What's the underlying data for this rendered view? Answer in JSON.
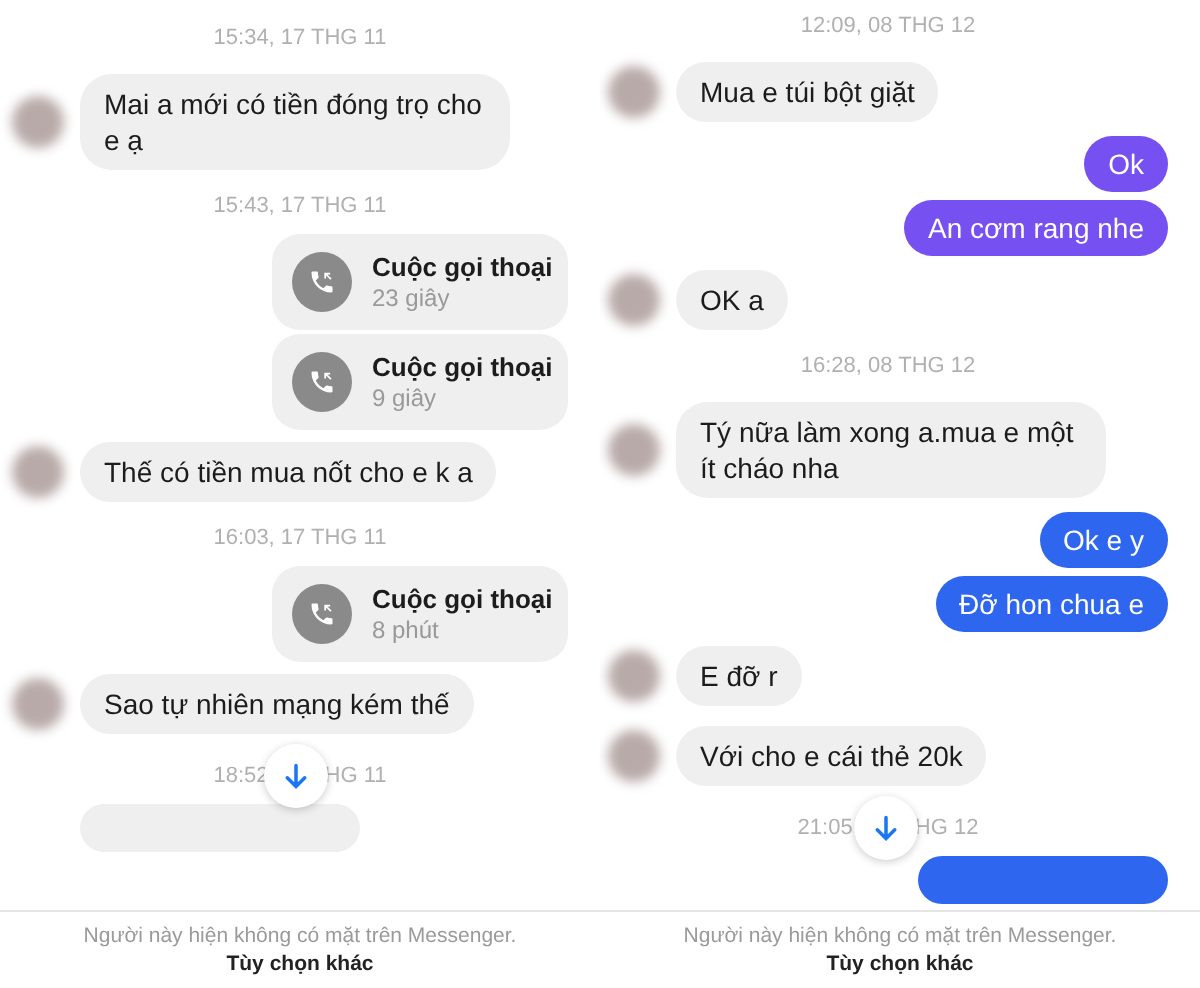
{
  "panels": [
    {
      "messages": [
        {
          "kind": "time",
          "text": "15:34, 17 THG 11"
        },
        {
          "kind": "incoming",
          "text": "Mai a mới có tiền đóng trọ cho e ạ"
        },
        {
          "kind": "time",
          "text": "15:43, 17 THG 11"
        },
        {
          "kind": "call",
          "title": "Cuộc gọi thoại",
          "duration": "23 giây"
        },
        {
          "kind": "call",
          "title": "Cuộc gọi thoại",
          "duration": "9 giây"
        },
        {
          "kind": "incoming",
          "text": "Thế có tiền mua nốt cho e k a"
        },
        {
          "kind": "time",
          "text": "16:03, 17 THG 11"
        },
        {
          "kind": "call",
          "title": "Cuộc gọi thoại",
          "duration": "8 phút"
        },
        {
          "kind": "incoming",
          "text": "Sao tự nhiên mạng kém thế"
        },
        {
          "kind": "time_covered",
          "before": "18:52",
          "after": "HG 11"
        },
        {
          "kind": "cut_incoming"
        }
      ],
      "footer": {
        "text": "Người này hiện không có mặt trên Messenger.",
        "link": "Tùy chọn khác"
      }
    },
    {
      "messages": [
        {
          "kind": "time",
          "text": "12:09, 08 THG 12"
        },
        {
          "kind": "incoming",
          "text": "Mua e túi bột giặt"
        },
        {
          "kind": "outgoing",
          "text": "Ok",
          "color": "#7650f0"
        },
        {
          "kind": "outgoing",
          "text": "An cơm rang nhe",
          "color": "#7650f0"
        },
        {
          "kind": "incoming",
          "text": "OK a"
        },
        {
          "kind": "time",
          "text": "16:28, 08 THG 12"
        },
        {
          "kind": "incoming",
          "text": "Tý nữa làm xong a.mua e một ít cháo nha"
        },
        {
          "kind": "outgoing",
          "text": "Ok e y",
          "color": "#2f66f0"
        },
        {
          "kind": "outgoing",
          "text": "Đỡ hon chua e",
          "color": "#2f66f0"
        },
        {
          "kind": "incoming",
          "text": "E đỡ r"
        },
        {
          "kind": "incoming",
          "text": "Với cho e cái thẻ 20k"
        },
        {
          "kind": "time_covered",
          "before": "21:05,",
          "after": "HG 12"
        },
        {
          "kind": "cut_outgoing",
          "color": "#2f66f0"
        }
      ],
      "footer": {
        "text": "Người này hiện không có mặt trên Messenger.",
        "link": "Tùy chọn khác"
      }
    }
  ]
}
